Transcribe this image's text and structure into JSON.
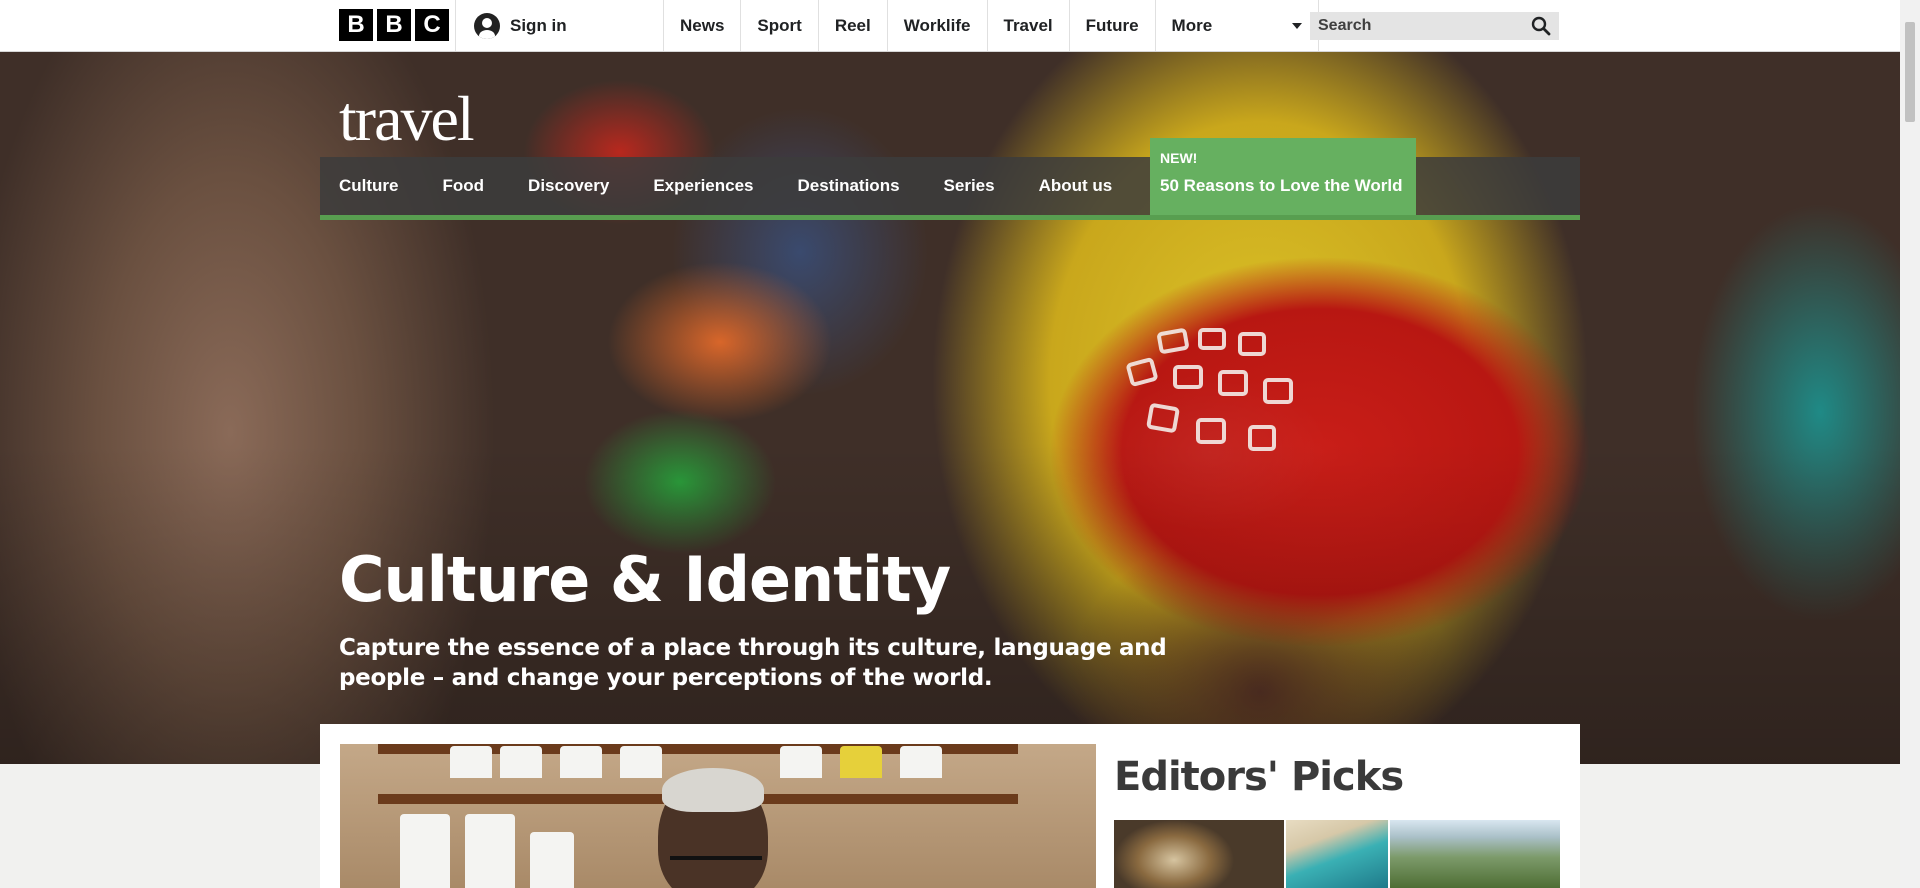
{
  "bbc_bar": {
    "logo_letters": [
      "B",
      "B",
      "C"
    ],
    "sign_in": "Sign in",
    "nav": [
      "News",
      "Sport",
      "Reel",
      "Worklife",
      "Travel",
      "Future"
    ],
    "more": "More",
    "search_placeholder": "Search"
  },
  "travel": {
    "logo": "travel",
    "nav": [
      "Culture",
      "Food",
      "Discovery",
      "Experiences",
      "Destinations",
      "Series",
      "About us"
    ],
    "promo": {
      "badge": "NEW!",
      "title": "50 Reasons to Love the World"
    }
  },
  "hero": {
    "title": "Culture & Identity",
    "subtitle": "Capture the essence of a place through its culture, language and people – and change your perceptions of the world."
  },
  "editors": {
    "title": "Editors' Picks"
  },
  "colors": {
    "accent_green": "#589e50",
    "promo_green": "#66b060"
  }
}
